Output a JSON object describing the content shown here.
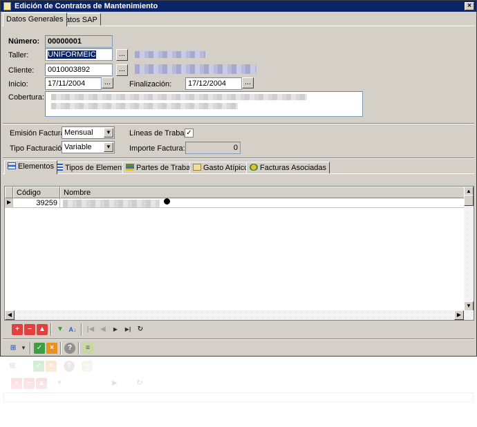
{
  "window": {
    "title": "Edición de Contratos de Mantenimiento",
    "close_glyph": "×"
  },
  "top_tabs": [
    {
      "label": "Datos Generales",
      "active": true
    },
    {
      "label": "Datos SAP",
      "active": false
    }
  ],
  "form": {
    "numero_label": "Número:",
    "numero_value": "00000001",
    "taller_label": "Taller:",
    "taller_value": "UNIFORMEIC",
    "cliente_label": "Cliente:",
    "cliente_value": "0010003892",
    "inicio_label": "Inicio:",
    "inicio_value": "17/11/2004",
    "finalizacion_label": "Finalización:",
    "finalizacion_value": "17/12/2004",
    "cobertura_label": "Cobertura:",
    "emision_label": "Emisión Facturas:",
    "emision_value": "Mensual",
    "tipo_fact_label": "Tipo Facturación:",
    "tipo_fact_value": "Variable",
    "lineas_label": "Líneas de Trabajo",
    "lineas_checked": true,
    "importe_label": "Importe Factura:",
    "importe_value": "0",
    "ellipsis": "...",
    "check_glyph": "✓",
    "arrow_glyph": "▼"
  },
  "bottom_tabs": [
    {
      "label": "Elementos",
      "icon": "elements-icon",
      "active": true
    },
    {
      "label": "Tipos de Elementos",
      "icon": "list-icon",
      "active": false
    },
    {
      "label": "Partes de Trabajo",
      "icon": "work-parts-icon",
      "active": false
    },
    {
      "label": "Gasto Atípico",
      "icon": "expense-icon",
      "active": false
    },
    {
      "label": "Facturas Asociadas",
      "icon": "invoice-icon",
      "active": false
    }
  ],
  "grid": {
    "columns": [
      "Código",
      "Nombre"
    ],
    "rows": [
      {
        "codigo": "39259"
      }
    ]
  },
  "colors": {
    "selection": "#0a246a",
    "window_bg": "#d4d0c8",
    "add_red": "#e04040",
    "filter_green": "#2aa02a",
    "accept_green": "#3aa040",
    "cancel_orange": "#e89020"
  }
}
